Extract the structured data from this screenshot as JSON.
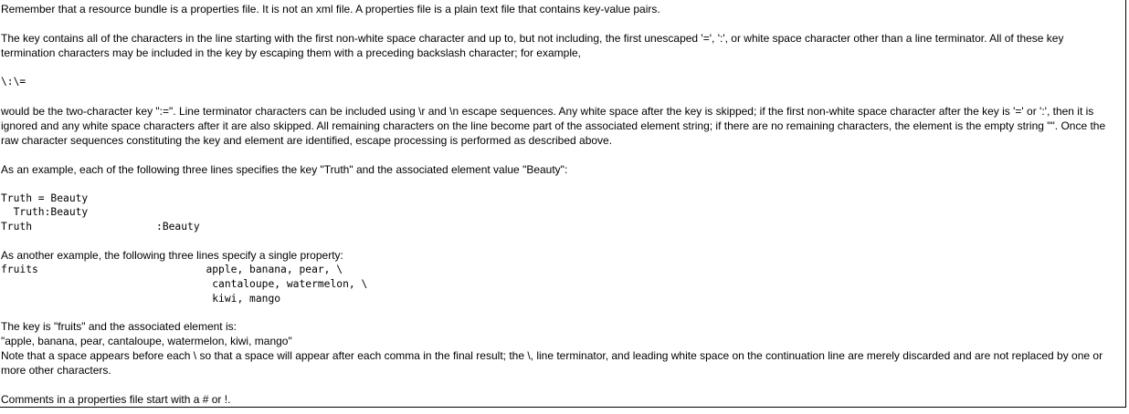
{
  "document": {
    "intro": "Remember that a resource bundle is a properties file. It is not an xml file. A properties file is a plain text file that contains key-value pairs.",
    "key_definition": "The key contains all of the characters in the line starting with the first non-white space character and up to, but not including, the first unescaped '=', ':', or white space character other than a line terminator. All of these key termination characters may be included in the key by escaping them with a preceding backslash character; for example,",
    "escape_example": "\\:\\=",
    "key_explanation": "would be the two-character key \":=\". Line terminator characters can be included using \\r and \\n escape sequences. Any white space after the key is skipped; if the first non-white space character after the key is '=' or ':', then it is ignored and any white space characters after it are also skipped. All remaining characters on the line become part of the associated element string; if there are no remaining characters, the element is the empty string \"\". Once the raw character sequences constituting the key and element are identified, escape processing is performed as described above.",
    "example1_intro": "As an example, each of the following three lines specifies the key \"Truth\" and the associated element value \"Beauty\":",
    "example1_code": "Truth = Beauty\n  Truth:Beauty\nTruth                    :Beauty",
    "example2_intro": "As another example, the following three lines specify a single property:",
    "example2_code": "fruits                           apple, banana, pear, \\\n                                  cantaloupe, watermelon, \\\n                                  kiwi, mango",
    "result_intro": "The key is \"fruits\" and the associated element is:",
    "result_value": "\"apple, banana, pear, cantaloupe, watermelon, kiwi, mango\"",
    "note": "Note that a space appears before each \\ so that a space will appear after each comma in the final result; the \\, line terminator, and leading white space on the continuation line are merely discarded and are not replaced by one or more other characters.",
    "comments": "Comments in a properties file start with a # or !."
  }
}
